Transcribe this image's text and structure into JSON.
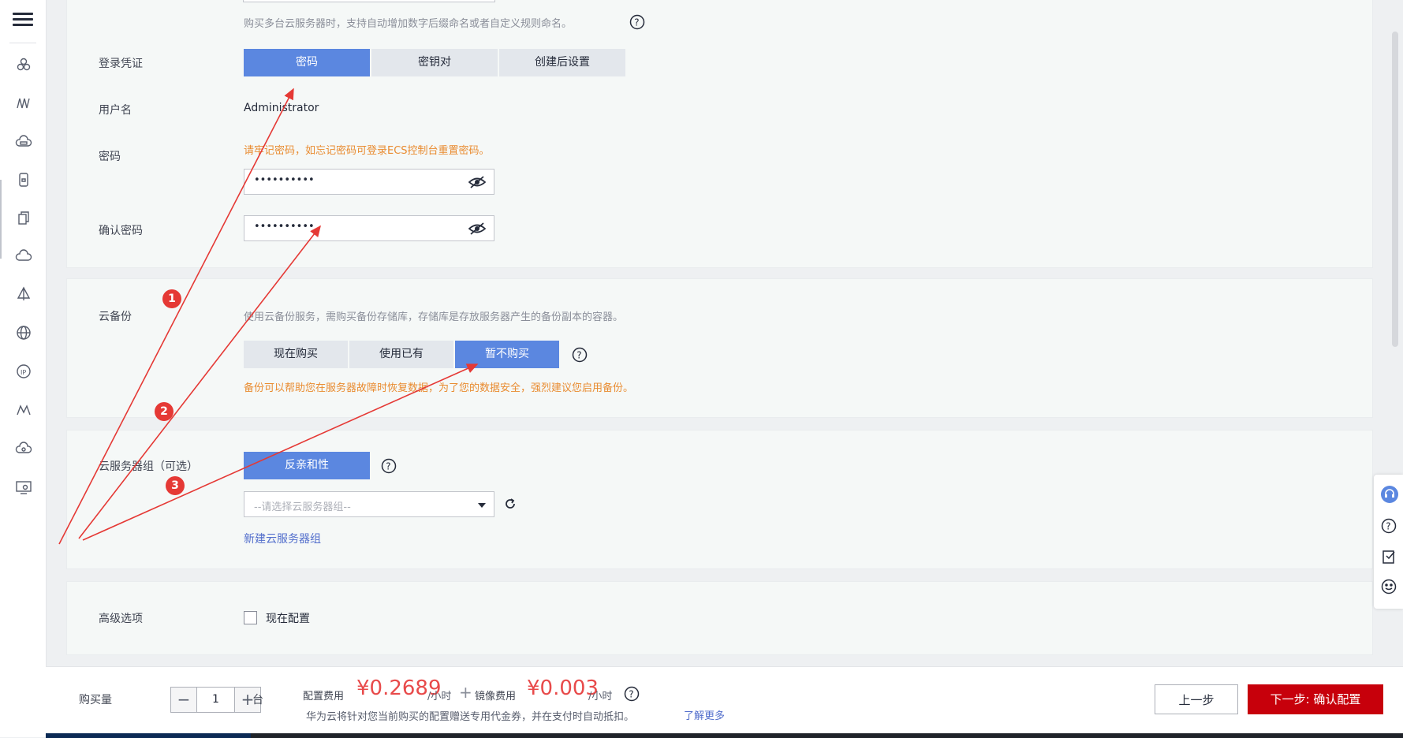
{
  "sidebar": {
    "icons": [
      "menu-icon",
      "cube-cluster-icon",
      "network-icon",
      "cloud-storage-icon",
      "server-icon",
      "copy-icon",
      "cloud-icon",
      "triangle-icon",
      "globe-icon",
      "ip-icon",
      "mountain-icon",
      "cloud-eye-icon",
      "monitor-icon"
    ]
  },
  "top_hint": "购买多台云服务器时，支持自动增加数字后缀命名或者自定义规则命名。",
  "login": {
    "label": "登录凭证",
    "options": [
      "密码",
      "密钥对",
      "创建后设置"
    ],
    "selected": "密码"
  },
  "username": {
    "label": "用户名",
    "value": "Administrator"
  },
  "password": {
    "label": "密码",
    "warning": "请牢记密码，如忘记密码可登录ECS控制台重置密码。",
    "value": "••••••••••"
  },
  "confirm_password": {
    "label": "确认密码",
    "value": "••••••••••"
  },
  "backup": {
    "label": "云备份",
    "hint": "使用云备份服务，需购买备份存储库，存储库是存放服务器产生的备份副本的容器。",
    "options": [
      "现在购买",
      "使用已有",
      "暂不购买"
    ],
    "selected": "暂不购买",
    "warning": "备份可以帮助您在服务器故障时恢复数据，为了您的数据安全，强烈建议您启用备份。"
  },
  "server_group": {
    "label": "云服务器组（可选）",
    "option": "反亲和性",
    "select_placeholder": "--请选择云服务器组--",
    "new_link": "新建云服务器组"
  },
  "advanced": {
    "label": "高级选项",
    "checkbox_label": "现在配置",
    "checked": false
  },
  "footer": {
    "qty_label": "购买量",
    "qty_value": "1",
    "qty_unit": "台",
    "config_fee_label": "配置费用",
    "config_fee": "¥0.2689",
    "config_fee_unit": "/小时",
    "plus": "+",
    "image_fee_label": "镜像费用",
    "image_fee": "¥0.003",
    "image_fee_unit": "/小时",
    "note": "华为云将针对您当前购买的配置赠送专用代金券，并在支付时自动抵扣。",
    "learn_more": "了解更多",
    "prev_button": "上一步",
    "next_button": "下一步: 确认配置"
  },
  "annotations": {
    "badges": [
      "1",
      "2",
      "3"
    ],
    "color": "#e53935"
  },
  "colors": {
    "primary_blue": "#5b87e0",
    "warning_orange": "#e98b30",
    "brand_red": "#c7000b",
    "price_red": "#e84a4a",
    "link_blue": "#526ecc"
  }
}
